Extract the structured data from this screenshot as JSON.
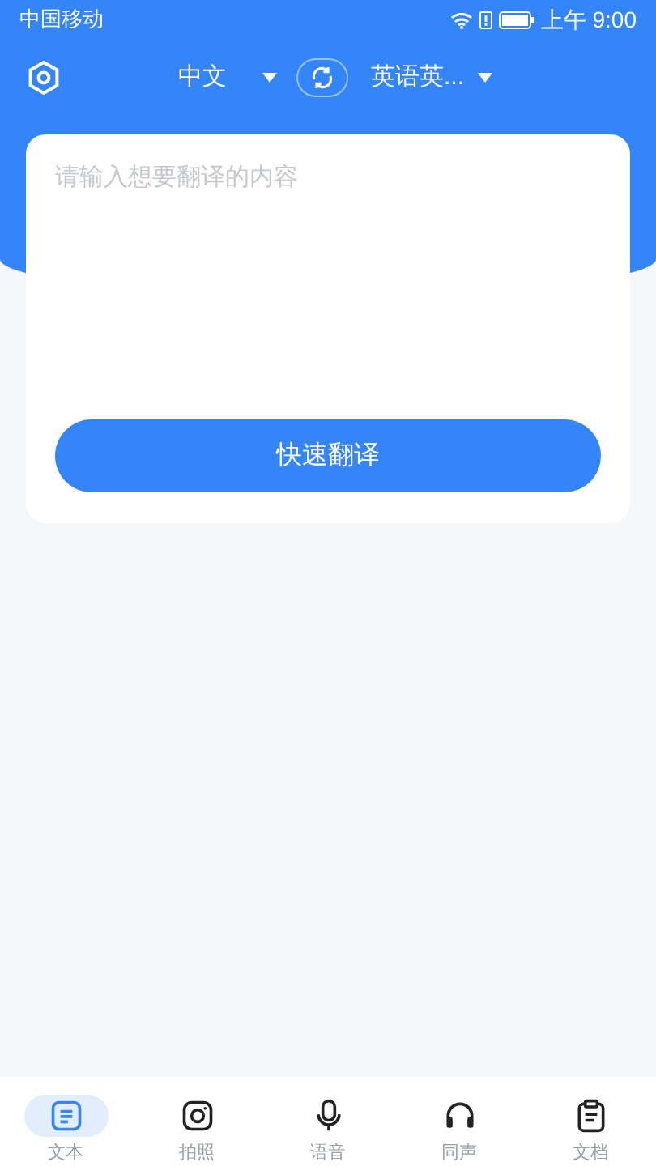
{
  "status_bar": {
    "carrier": "中国移动",
    "time": "上午 9:00"
  },
  "toolbar": {
    "source_language": "中文",
    "target_language": "英语英..."
  },
  "input": {
    "placeholder": "请输入想要翻译的内容"
  },
  "translate_button": "快速翻译",
  "tabs": [
    {
      "label": "文本",
      "selected": true,
      "kind": "text"
    },
    {
      "label": "拍照",
      "selected": false,
      "kind": "camera"
    },
    {
      "label": "语音",
      "selected": false,
      "kind": "voice"
    },
    {
      "label": "同声",
      "selected": false,
      "kind": "simul"
    },
    {
      "label": "文档",
      "selected": false,
      "kind": "document"
    }
  ]
}
